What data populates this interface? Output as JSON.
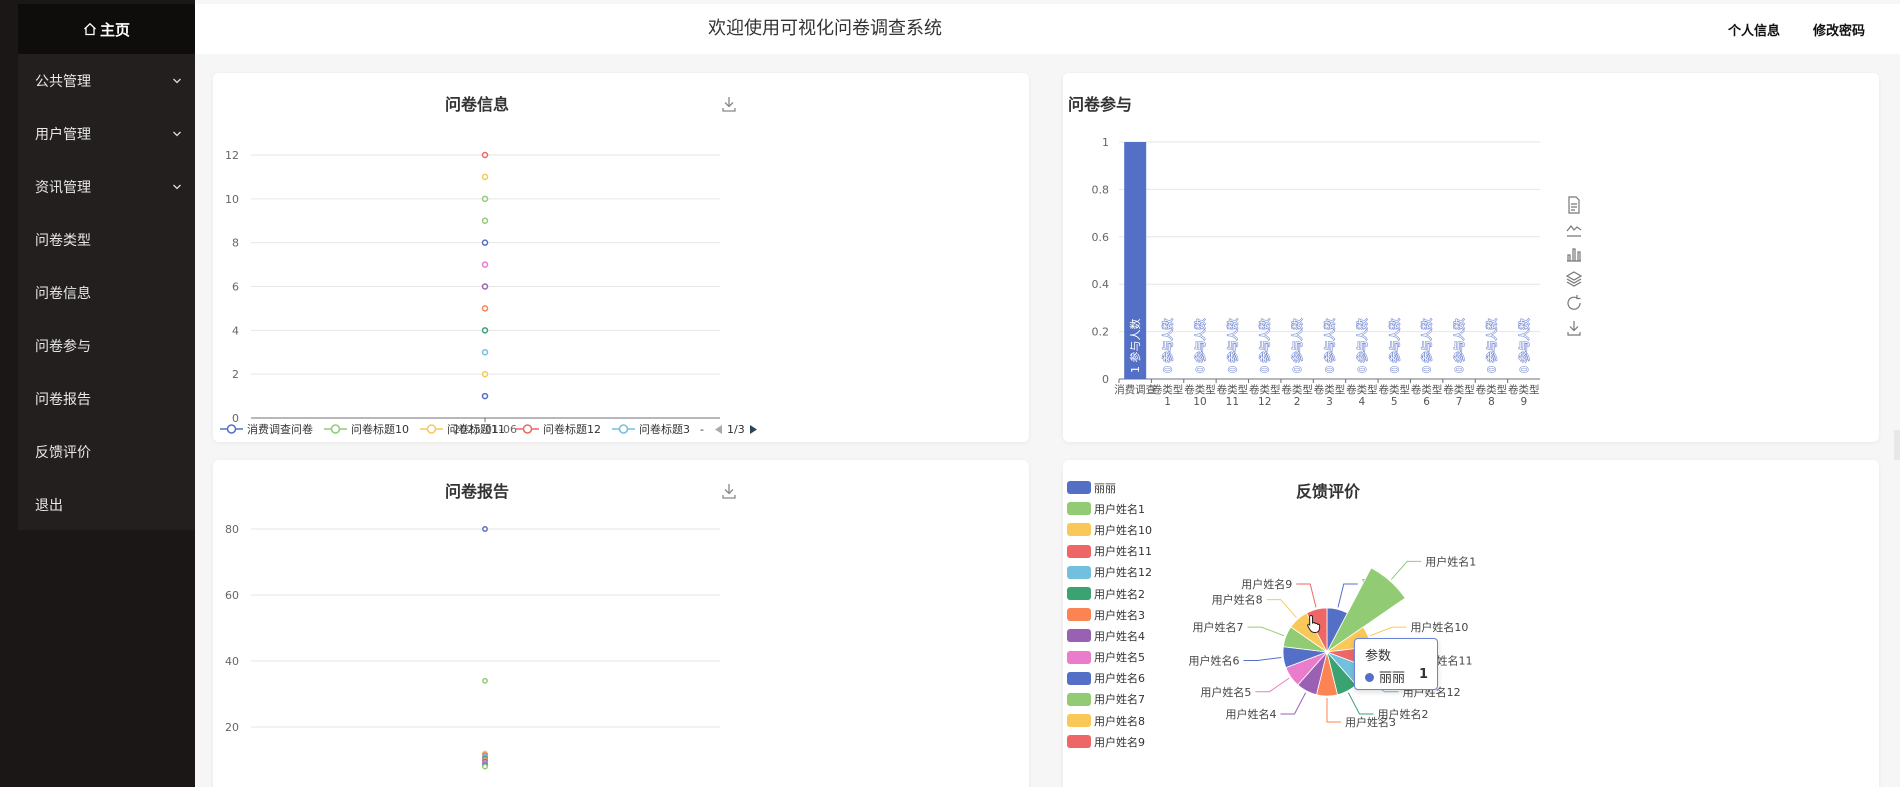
{
  "sidebar": {
    "home": "主页",
    "items": [
      {
        "label": "公共管理",
        "expandable": true
      },
      {
        "label": "用户管理",
        "expandable": true
      },
      {
        "label": "资讯管理",
        "expandable": true
      },
      {
        "label": "问卷类型",
        "expandable": false
      },
      {
        "label": "问卷信息",
        "expandable": false
      },
      {
        "label": "问卷参与",
        "expandable": false
      },
      {
        "label": "问卷报告",
        "expandable": false
      },
      {
        "label": "反馈评价",
        "expandable": false
      },
      {
        "label": "退出",
        "expandable": false
      }
    ]
  },
  "header": {
    "title": "欢迎使用可视化问卷调查系统",
    "profile": "个人信息",
    "password": "修改密码"
  },
  "colors": {
    "series": [
      "#5470c6",
      "#91cc75",
      "#fac858",
      "#ee6666",
      "#73c0de",
      "#3ba272",
      "#fc8452",
      "#9a60b4",
      "#ea7ccc"
    ]
  },
  "panels": {
    "info": {
      "title": "问卷信息"
    },
    "participate": {
      "title": "问卷参与"
    },
    "report": {
      "title": "问卷报告"
    },
    "feedback": {
      "title": "反馈评价"
    }
  },
  "tooltip": {
    "title": "参数",
    "name": "丽丽",
    "value": "1"
  },
  "chart_data": [
    {
      "type": "scatter",
      "title": "问卷信息",
      "x": [
        "2025-01-06"
      ],
      "ylim": [
        0,
        12
      ],
      "yticks": [
        0,
        2,
        4,
        6,
        8,
        10,
        12
      ],
      "grid": true,
      "series": [
        {
          "name": "消费调查问卷",
          "values": [
            1
          ]
        },
        {
          "name": "问卷标题10",
          "values": [
            9
          ]
        },
        {
          "name": "问卷标题11",
          "values": [
            2
          ]
        },
        {
          "name": "问卷标题12",
          "values": [
            12
          ]
        },
        {
          "name": "问卷标题3",
          "values": [
            3
          ]
        },
        {
          "name": "",
          "values": [
            4
          ]
        },
        {
          "name": "",
          "values": [
            5
          ]
        },
        {
          "name": "",
          "values": [
            6
          ]
        },
        {
          "name": "",
          "values": [
            7
          ]
        },
        {
          "name": "",
          "values": [
            8
          ]
        },
        {
          "name": "",
          "values": [
            10
          ]
        },
        {
          "name": "",
          "values": [
            11
          ]
        }
      ],
      "legend_position": "bottom",
      "legend_page": "1/3",
      "legend_more": "-"
    },
    {
      "type": "bar",
      "title": "问卷参与",
      "categories": [
        "消费调查",
        "问卷类型1",
        "问卷类型10",
        "问卷类型11",
        "问卷类型12",
        "问卷类型2",
        "问卷类型3",
        "问卷类型4",
        "问卷类型5",
        "问卷类型6",
        "问卷类型7",
        "问卷类型8",
        "问卷类型9"
      ],
      "tick_labels": [
        "消费调查",
        "卷类型\n1",
        "卷类型\n10",
        "卷类型\n11",
        "卷类型\n12",
        "卷类型\n2",
        "卷类型\n3",
        "卷类型\n4",
        "卷类型\n5",
        "卷类型\n6",
        "卷类型\n7",
        "卷类型\n8",
        "卷类型\n9"
      ],
      "values": [
        1,
        0,
        0,
        0,
        0,
        0,
        0,
        0,
        0,
        0,
        0,
        0,
        0
      ],
      "data_label_name": "参与人数",
      "ylim": [
        0,
        1
      ],
      "yticks": [
        "0",
        "0.2",
        "0.4",
        "0.6",
        "0.8",
        "1"
      ],
      "grid": true,
      "toolbox": [
        "data-view",
        "line",
        "bar",
        "stack",
        "restore",
        "save"
      ]
    },
    {
      "type": "scatter",
      "title": "问卷报告",
      "yticks": [
        20,
        40,
        60,
        80
      ],
      "grid": true,
      "series": [
        {
          "name": "",
          "values": [
            80
          ]
        },
        {
          "name": "",
          "values": [
            34
          ]
        },
        {
          "name": "",
          "values": [
            12,
            11.5,
            11,
            10.5,
            10,
            9.5,
            9,
            8.5,
            8
          ]
        }
      ]
    },
    {
      "type": "pie",
      "title": "反馈评价",
      "rose": true,
      "legend_position": "left",
      "categories": [
        "丽丽",
        "用户姓名1",
        "用户姓名10",
        "用户姓名11",
        "用户姓名12",
        "用户姓名2",
        "用户姓名3",
        "用户姓名4",
        "用户姓名5",
        "用户姓名6",
        "用户姓名7",
        "用户姓名8",
        "用户姓名9"
      ],
      "values": [
        1,
        4,
        1,
        1,
        1,
        1,
        1,
        1,
        1,
        1,
        1,
        1,
        1
      ]
    }
  ]
}
